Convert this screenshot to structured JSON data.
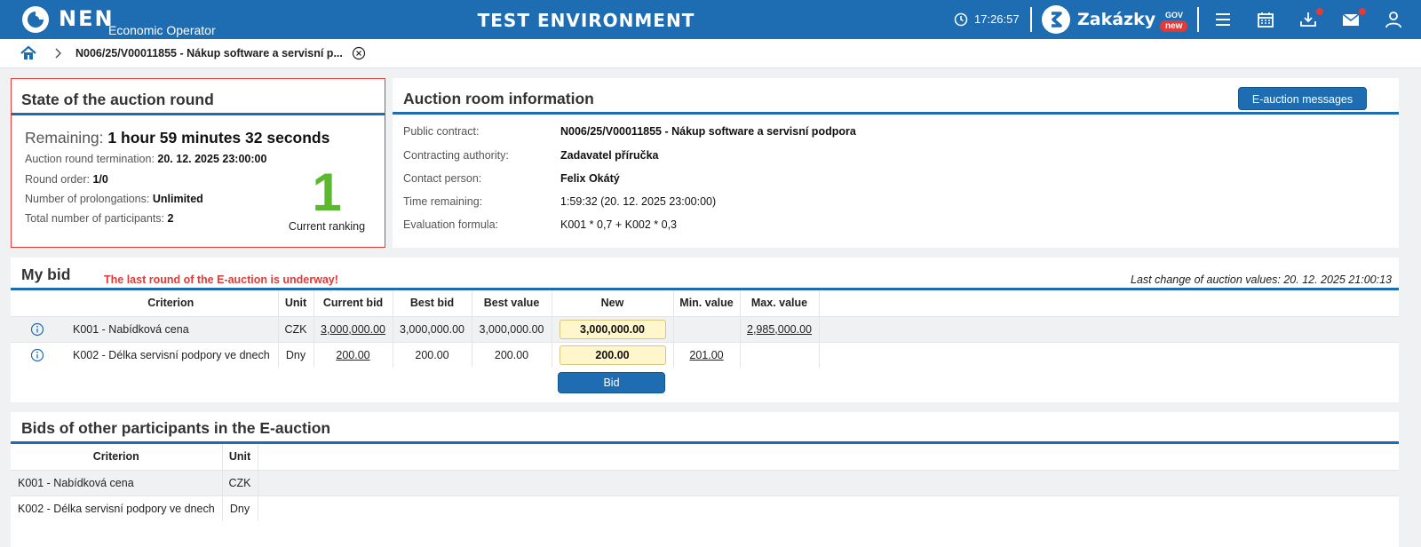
{
  "header": {
    "brand": "NEN",
    "brand_sub": "Economic Operator",
    "env_title": "TEST ENVIRONMENT",
    "time": "17:26:57",
    "zakazky_label": "Zakázky",
    "zakazky_gov": "GOV",
    "zakazky_badge": "new",
    "colors": {
      "primary": "#1e6db3",
      "alert": "#e53935"
    }
  },
  "breadcrumb": {
    "current": "N006/25/V00011855 - Nákup software a servisní p..."
  },
  "state_panel": {
    "title": "State of the auction round",
    "remaining_label": "Remaining:",
    "remaining_value": "1 hour 59 minutes 32 seconds",
    "termination_label": "Auction round termination:",
    "termination_value": "20. 12. 2025 23:00:00",
    "round_order_label": "Round order:",
    "round_order_value": "1/0",
    "prolongations_label": "Number of prolongations:",
    "prolongations_value": "Unlimited",
    "participants_label": "Total number of participants:",
    "participants_value": "2",
    "current_ranking_value": "1",
    "current_ranking_label": "Current ranking",
    "ranking_color": "#5cb82e"
  },
  "info_panel": {
    "title": "Auction room information",
    "messages_button": "E-auction messages",
    "rows": [
      {
        "label": "Public contract:",
        "value": "N006/25/V00011855 - Nákup software a servisní podpora"
      },
      {
        "label": "Contracting authority:",
        "value": "Zadavatel příručka"
      },
      {
        "label": "Contact person:",
        "value": "Felix Okátý"
      },
      {
        "label": "Time remaining:",
        "value": "1:59:32 (20. 12. 2025 23:00:00)"
      },
      {
        "label": "Evaluation formula:",
        "value": "K001 * 0,7 + K002 * 0,3"
      }
    ]
  },
  "my_bid": {
    "title": "My bid",
    "warning": "The last round of the E-auction is underway!",
    "last_change": "Last change of auction values: 20. 12. 2025 21:00:13",
    "columns": {
      "criterion": "Criterion",
      "unit": "Unit",
      "current_bid": "Current bid",
      "best_bid": "Best bid",
      "best_value": "Best value",
      "new": "New",
      "min_value": "Min. value",
      "max_value": "Max. value"
    },
    "rows": [
      {
        "criterion": "K001 - Nabídková cena",
        "unit": "CZK",
        "current_bid": "3,000,000.00",
        "best_bid": "3,000,000.00",
        "best_value": "3,000,000.00",
        "new": "3,000,000.00",
        "min_value": "",
        "max_value": "2,985,000.00"
      },
      {
        "criterion": "K002 - Délka servisní podpory ve dnech",
        "unit": "Dny",
        "current_bid": "200.00",
        "best_bid": "200.00",
        "best_value": "200.00",
        "new": "200.00",
        "min_value": "201.00",
        "max_value": ""
      }
    ],
    "bid_button": "Bid"
  },
  "others": {
    "title": "Bids of other participants in the E-auction",
    "columns": {
      "criterion": "Criterion",
      "unit": "Unit"
    },
    "rows": [
      {
        "criterion": "K001 - Nabídková cena",
        "unit": "CZK"
      },
      {
        "criterion": "K002 - Délka servisní podpory ve dnech",
        "unit": "Dny"
      }
    ]
  }
}
